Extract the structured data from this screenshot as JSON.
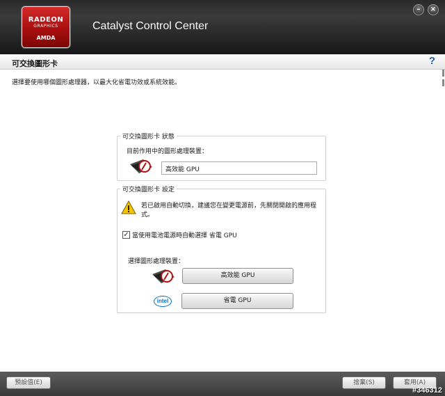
{
  "window": {
    "app_title": "Catalyst Control Center",
    "logo": {
      "line1": "RADEON",
      "line2": "GRAPHICS",
      "line3": "AMDA"
    }
  },
  "window_buttons": {
    "minimize": "–",
    "close": "×"
  },
  "section": {
    "title": "可交換圖形卡",
    "help": "?",
    "description": "選擇要使用哪個圖形處理器，以最大化省電功效或系統效能。"
  },
  "status_group": {
    "label": "可交換圖形卡 狀態",
    "current_label": "目前作用中的圖形處理裝置：",
    "current_value": "高效能 GPU",
    "icon": "radeon-gpu-icon"
  },
  "settings_group": {
    "label": "可交換圖形卡 設定",
    "warning_text": "若已啟用自動切換，建議您在變更電源前，先關閉開啟的應用程式。",
    "warning_icon": "warning-icon",
    "battery_checkbox": {
      "label": "當使用電池電源時自動選擇 省電 GPU",
      "checked": true
    },
    "select_label": "選擇圖形處理裝置：",
    "high_perf_button": "高效能 GPU",
    "power_saving_button": "省電 GPU",
    "intel_logo": "intel"
  },
  "footer": {
    "defaults_button": "預設值(E)",
    "discard_button": "捨棄(S)",
    "apply_button": "套用(A)",
    "watermark": "#346312"
  },
  "colors": {
    "header_bg": "#2a2a2a",
    "logo_red": "#b81616",
    "help_blue": "#1d5fa8",
    "intel_blue": "#0071c5",
    "footer_bg": "#4a4a4a"
  }
}
